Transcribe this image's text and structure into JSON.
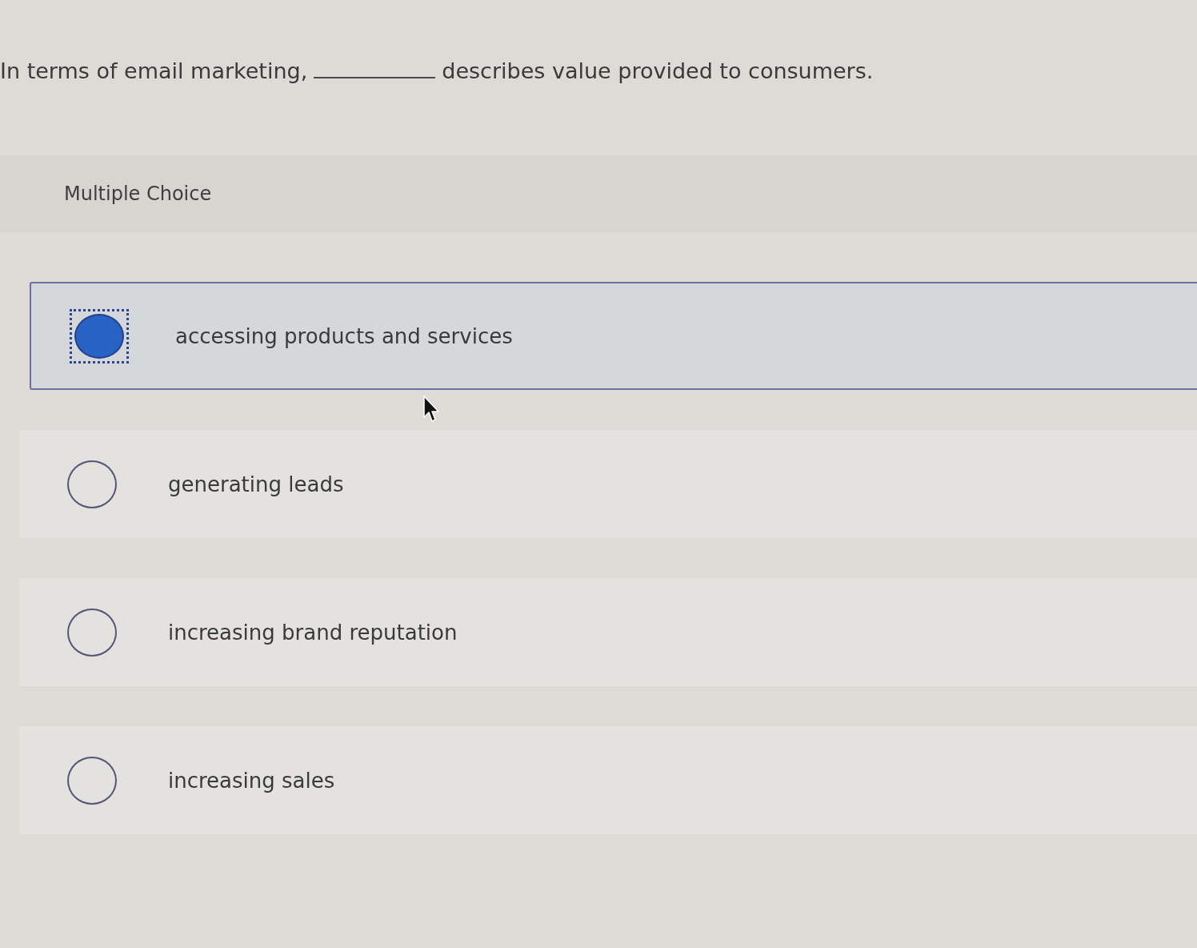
{
  "question": {
    "text_before": "In terms of email marketing,",
    "text_after": "describes value provided to consumers."
  },
  "section_label": "Multiple Choice",
  "options": [
    {
      "label": "accessing products and services",
      "selected": true
    },
    {
      "label": "generating leads",
      "selected": false
    },
    {
      "label": "increasing brand reputation",
      "selected": false
    },
    {
      "label": "increasing sales",
      "selected": false
    }
  ]
}
